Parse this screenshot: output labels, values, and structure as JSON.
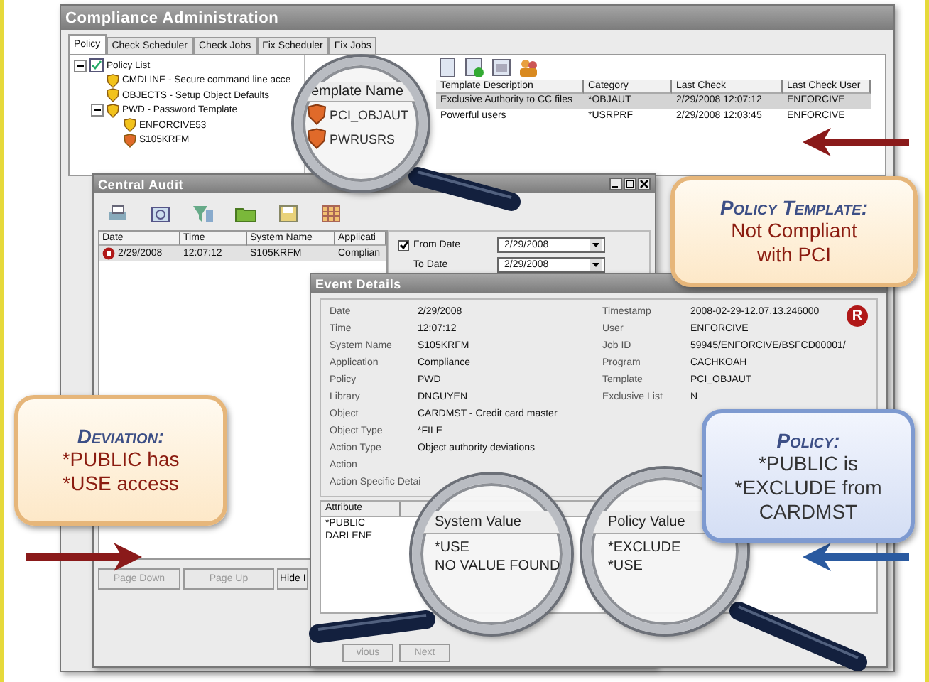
{
  "main_window": {
    "title": "Compliance Administration",
    "tabs": [
      {
        "label": "Policy",
        "selected": true
      },
      {
        "label": "Check Scheduler",
        "selected": false
      },
      {
        "label": "Check Jobs",
        "selected": false
      },
      {
        "label": "Fix Scheduler",
        "selected": false
      },
      {
        "label": "Fix Jobs",
        "selected": false
      }
    ],
    "tree": [
      {
        "label": "Policy List",
        "kind": "list",
        "expanded": true,
        "children": [
          {
            "label": "CMDLINE - Secure command line acce",
            "kind": "policy"
          },
          {
            "label": "OBJECTS - Setup Object Defaults",
            "kind": "policy"
          },
          {
            "label": "PWD - Password Template",
            "kind": "policy",
            "expanded": true,
            "children": [
              {
                "label": "ENFORCIVE53",
                "kind": "policy"
              },
              {
                "label": "S105KRFM",
                "kind": "system"
              }
            ]
          }
        ]
      }
    ],
    "templates": {
      "name_header": "emplate Name",
      "columns": [
        "Template Description",
        "Category",
        "Last Check",
        "Last Check User"
      ],
      "rows": [
        {
          "name": "PCI_OBJAUT",
          "description": "Exclusive Authority to CC files",
          "category": "*OBJAUT",
          "last_check": "2/29/2008 12:07:12",
          "user": "ENFORCIVE",
          "selected": true
        },
        {
          "name": "PWRUSRS",
          "description": "Powerful users",
          "category": "*USRPRF",
          "last_check": "2/29/2008 12:03:45",
          "user": "ENFORCIVE",
          "selected": false
        }
      ]
    }
  },
  "audit_window": {
    "title": "Central Audit",
    "columns": [
      "Date",
      "Time",
      "System Name",
      "Applicati"
    ],
    "rows": [
      {
        "cells": [
          "2/29/2008",
          "12:07:12",
          "S105KRFM",
          "Complian"
        ]
      }
    ],
    "from_date": {
      "label": "From Date",
      "checked": true,
      "value": "2/29/2008"
    },
    "to_date": {
      "label": "To Date",
      "value": "2/29/2008"
    },
    "buttons": [
      {
        "label": "Page Down",
        "disabled": true
      },
      {
        "label": "Page Up",
        "disabled": true
      },
      {
        "label": "Hide I",
        "disabled": false
      }
    ]
  },
  "event_window": {
    "title": "Event Details",
    "badge": "R",
    "left_fields": [
      {
        "label": "Date",
        "value": "2/29/2008"
      },
      {
        "label": "Time",
        "value": "12:07:12"
      },
      {
        "label": "System Name",
        "value": "S105KRFM"
      },
      {
        "label": "Application",
        "value": "Compliance"
      },
      {
        "label": "Policy",
        "value": "PWD"
      },
      {
        "label": "Library",
        "value": "DNGUYEN"
      },
      {
        "label": "Object",
        "value": "CARDMST - Credit card master"
      },
      {
        "label": "Object Type",
        "value": "*FILE"
      },
      {
        "label": "Action Type",
        "value": "Object authority deviations"
      },
      {
        "label": "Action"
      },
      {
        "label": "Action Specific Detai"
      }
    ],
    "right_fields": [
      {
        "label": "Timestamp",
        "value": "2008-02-29-12.07.13.246000"
      },
      {
        "label": "User",
        "value": "ENFORCIVE"
      },
      {
        "label": "Job ID",
        "value": "59945/ENFORCIVE/BSFCD00001/"
      },
      {
        "label": "Program",
        "value": "CACHKOAH"
      },
      {
        "label": "Template",
        "value": "PCI_OBJAUT"
      },
      {
        "label": "Exclusive List",
        "value": "N"
      }
    ],
    "attribute_header": "Attribute",
    "system_header": "System Value",
    "policy_header": "Policy Value",
    "attributes": [
      {
        "attribute": "*PUBLIC",
        "system_value": "*USE",
        "policy_value": "*EXCLUDE"
      },
      {
        "attribute": "DARLENE",
        "system_value": "NO VALUE FOUND",
        "policy_value": "*USE"
      }
    ],
    "buttons": [
      {
        "label": "vious",
        "disabled": true
      },
      {
        "label": "Next",
        "disabled": true
      }
    ]
  },
  "callouts": [
    {
      "kind": "template",
      "title": "Policy Template:",
      "lines": [
        "Not Compliant",
        "with PCI"
      ]
    },
    {
      "kind": "deviation",
      "title": "Deviation:",
      "lines": [
        "*PUBLIC has",
        "*USE access"
      ]
    },
    {
      "kind": "policy",
      "title": "Policy:",
      "lines": [
        "*PUBLIC is",
        "*EXCLUDE from",
        "CARDMST"
      ]
    }
  ]
}
